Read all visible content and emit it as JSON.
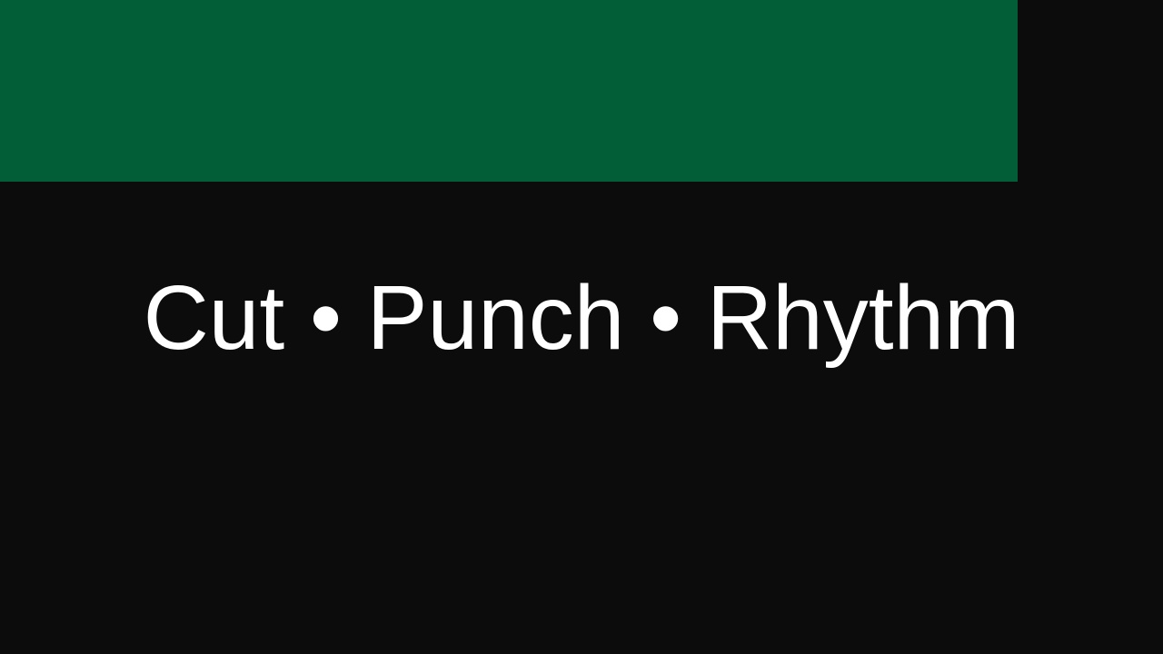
{
  "colors": {
    "background": "#0c0c0c",
    "band": "#025e37",
    "text": "#ffffff"
  },
  "headline": {
    "text": "Cut • Punch • Rhythm"
  }
}
